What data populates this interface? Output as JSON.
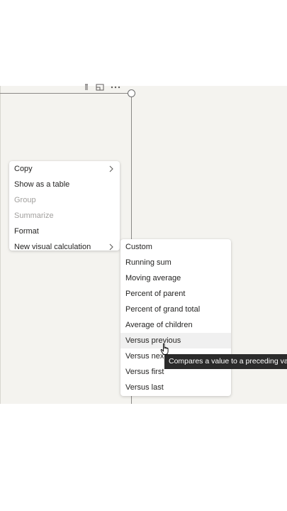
{
  "context_menu": {
    "items": [
      {
        "label": "Copy",
        "has_submenu": true,
        "enabled": true
      },
      {
        "label": "Show as a table",
        "has_submenu": false,
        "enabled": true
      },
      {
        "label": "Group",
        "has_submenu": false,
        "enabled": false
      },
      {
        "label": "Summarize",
        "has_submenu": false,
        "enabled": false
      },
      {
        "label": "Format",
        "has_submenu": false,
        "enabled": true
      },
      {
        "label": "New visual calculation",
        "has_submenu": true,
        "enabled": true
      }
    ]
  },
  "visual_calc_submenu": {
    "items": [
      {
        "label": "Custom"
      },
      {
        "label": "Running sum"
      },
      {
        "label": "Moving average"
      },
      {
        "label": "Percent of parent"
      },
      {
        "label": "Percent of grand total"
      },
      {
        "label": "Average of children"
      },
      {
        "label": "Versus previous",
        "hovered": true
      },
      {
        "label": "Versus next"
      },
      {
        "label": "Versus first"
      },
      {
        "label": "Versus last"
      }
    ]
  },
  "tooltip": {
    "text": "Compares a value to a preceding value"
  },
  "icons": {
    "header": [
      "filter-icon",
      "focus-mode-icon",
      "more-options-icon"
    ],
    "submenu_arrow": "chevron-right-icon",
    "cursor": "hand-pointer-cursor-icon"
  },
  "colors": {
    "canvas": "#f4f3ef",
    "menu_bg": "#ffffff",
    "hover_bg": "#f0f0f0",
    "tooltip_bg": "#2b2b2b",
    "disabled_text": "#a19f9d"
  }
}
